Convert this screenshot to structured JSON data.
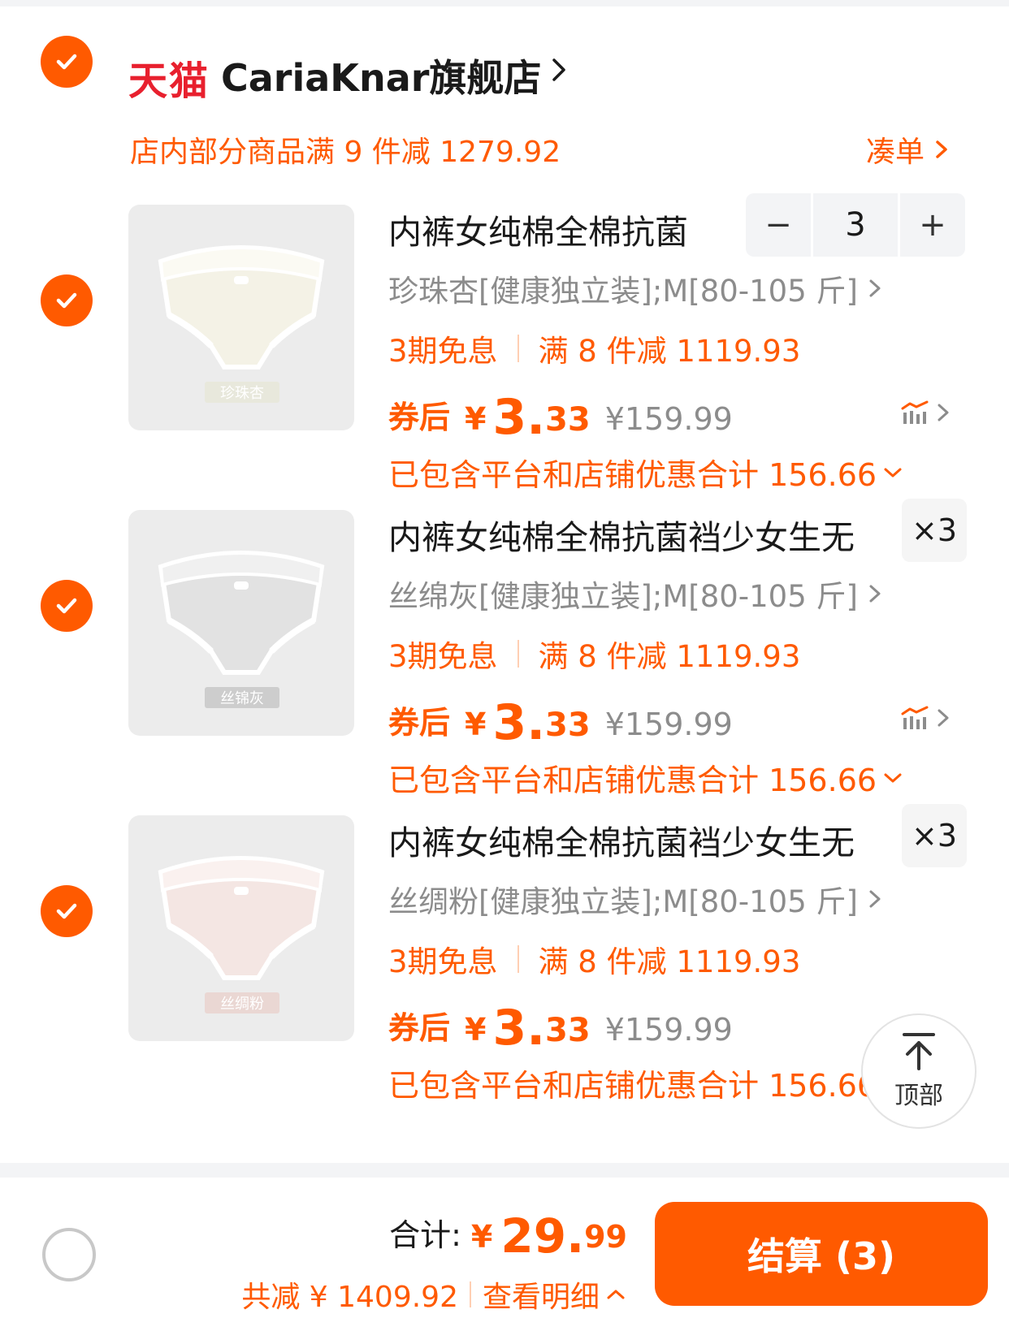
{
  "store": {
    "logo_text": "天猫",
    "name": "CariaKnar旗舰店",
    "promo": "店内部分商品满 9 件减 1279.92",
    "promo_link": "凑单"
  },
  "items": [
    {
      "thumb_label": "珍珠杏",
      "thumb_color": "#f4f2e6",
      "title": "内裤女纯棉全棉抗菌",
      "variant": "珍珠杏[健康独立装];M[80-105 斤]",
      "tag_installment": "3期免息",
      "tag_discount": "满 8 件减 1119.93",
      "price_label": "券后",
      "price_yen": "¥",
      "price_int": "3.",
      "price_dec": "33",
      "price_original": "¥159.99",
      "discount_note": "已包含平台和店铺优惠合计 156.66",
      "quantity": "3",
      "minus_label": "−",
      "plus_label": "+"
    },
    {
      "thumb_label": "丝锦灰",
      "thumb_color": "#e2e2e2",
      "title": "内裤女纯棉全棉抗菌裆少女生无",
      "variant": "丝绵灰[健康独立装];M[80-105 斤]",
      "tag_installment": "3期免息",
      "tag_discount": "满 8 件减 1119.93",
      "price_label": "券后",
      "price_yen": "¥",
      "price_int": "3.",
      "price_dec": "33",
      "price_original": "¥159.99",
      "discount_note": "已包含平台和店铺优惠合计 156.66",
      "quantity_badge": "×3"
    },
    {
      "thumb_label": "丝绸粉",
      "thumb_color": "#f4e6e3",
      "title": "内裤女纯棉全棉抗菌裆少女生无",
      "variant": "丝绸粉[健康独立装];M[80-105 斤]",
      "tag_installment": "3期免息",
      "tag_discount": "满 8 件减 1119.93",
      "price_label": "券后",
      "price_yen": "¥",
      "price_int": "3.",
      "price_dec": "33",
      "price_original": "¥159.99",
      "discount_note": "已包含平台和店铺优惠合计 156.66",
      "quantity_badge": "×3"
    }
  ],
  "back_to_top": "顶部",
  "footer": {
    "total_label": "合计:",
    "total_yen": "¥",
    "total_int": "29.",
    "total_dec": "99",
    "saving": "共减 ¥ 1409.92",
    "details_link": "查看明细",
    "checkout_label": "结算 (3)"
  },
  "colors": {
    "accent": "#ff5a00",
    "tmall_red": "#e8202e"
  }
}
